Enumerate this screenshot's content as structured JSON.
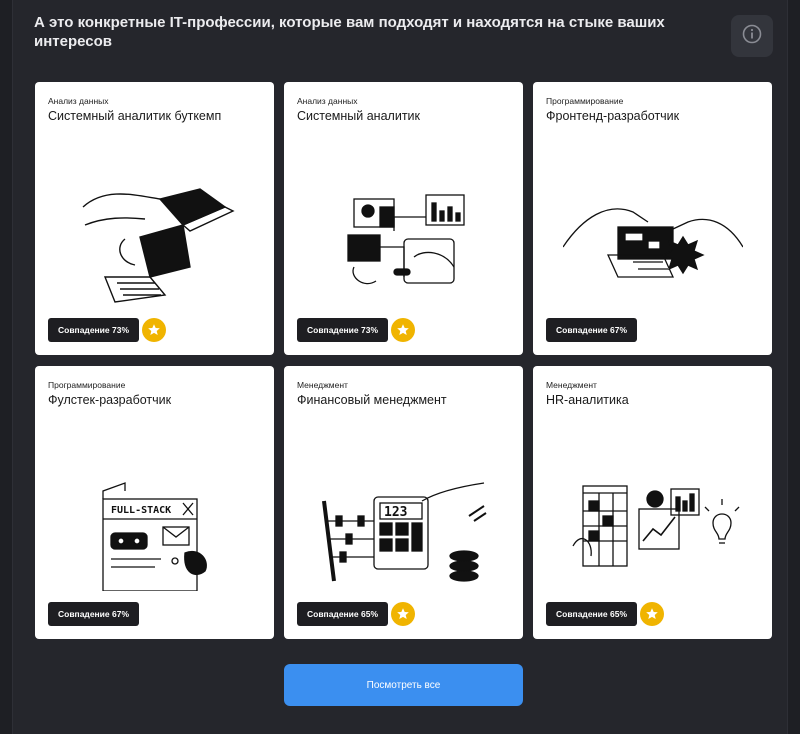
{
  "header": {
    "title": "А это конкретные IT-профессии, которые вам подходят и находятся на стыке ваших интересов",
    "info_icon": "info-icon"
  },
  "cards": [
    {
      "category": "Анализ данных",
      "name": "Системный аналитик буткемп",
      "match": "Совпадение 73%",
      "starred": true
    },
    {
      "category": "Анализ данных",
      "name": "Системный аналитик",
      "match": "Совпадение 73%",
      "starred": true
    },
    {
      "category": "Программирование",
      "name": "Фронтенд-разработчик",
      "match": "Совпадение 67%",
      "starred": false
    },
    {
      "category": "Программирование",
      "name": "Фулстек-разработчик",
      "match": "Совпадение 67%",
      "starred": false
    },
    {
      "category": "Менеджмент",
      "name": "Финансовый менеджмент",
      "match": "Совпадение 65%",
      "starred": true
    },
    {
      "category": "Менеджмент",
      "name": "HR-аналитика",
      "match": "Совпадение 65%",
      "starred": true
    }
  ],
  "illustrations": {
    "fullstack_label": "FULL-STACK",
    "calculator_digits": "123"
  },
  "cta": {
    "label": "Посмотреть все"
  },
  "colors": {
    "background": "#1e1f24",
    "panel": "#25262c",
    "card": "#ffffff",
    "badge": "#1e1e22",
    "star": "#f0b400",
    "button": "#3b8ff0"
  }
}
